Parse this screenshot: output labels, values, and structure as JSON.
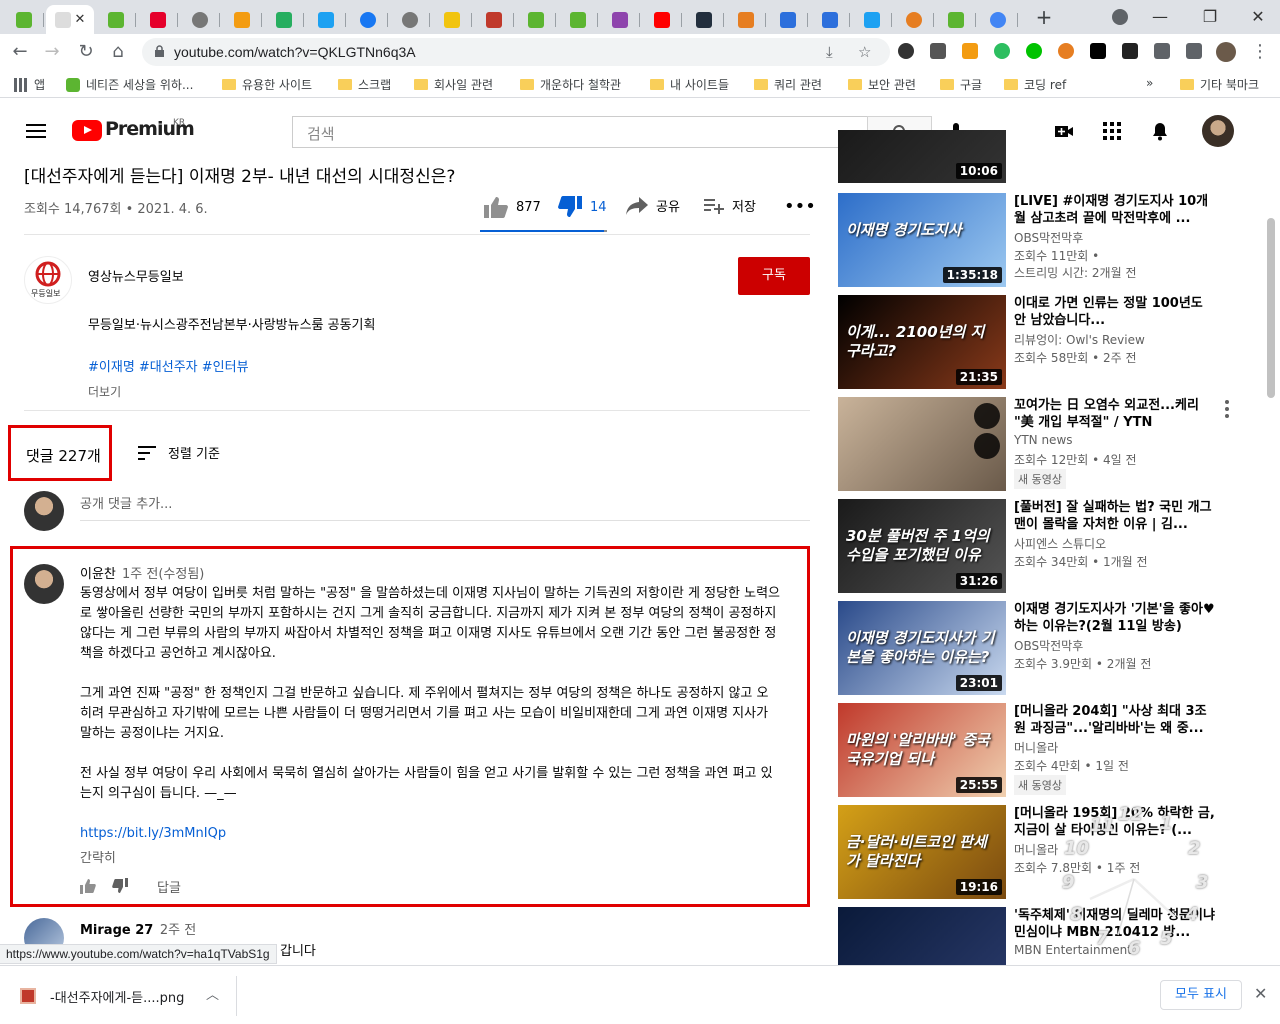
{
  "browser": {
    "url": "youtube.com/watch?v=QKLGTNn6q3A",
    "status_url": "https://www.youtube.com/watch?v=ha1qTVabS1g",
    "bookmarks": [
      "앱",
      "네티즌 세상을 위하...",
      "유용한 사이트",
      "스크랩",
      "회사일 관련",
      "개운하다 철학관",
      "내 사이트들",
      "쿼리 관련",
      "보안 관련",
      "구글",
      "코딩 ref",
      "»",
      "기타 북마크"
    ]
  },
  "header": {
    "brand": "Premium",
    "brand_region": "KR",
    "search_placeholder": "검색"
  },
  "video": {
    "title": "[대선주자에게 듣는다] 이재명 2부- 내년 대선의 시대정신은?",
    "views_date": "조회수 14,767회 • 2021. 4. 6.",
    "likes": "877",
    "dislikes": "14",
    "like_ratio": 0.98,
    "share": "공유",
    "save": "저장"
  },
  "channel": {
    "name": "영상뉴스무등일보",
    "logo_text": "무등일보",
    "subscribe": "구독",
    "description": "무등일보·뉴시스광주전남본부·사랑방뉴스룸 공동기획",
    "tags": "#이재명 #대선주자 #인터뷰",
    "more": "더보기"
  },
  "comments": {
    "count": "댓글 227개",
    "sort": "정렬 기준",
    "add_placeholder": "공개 댓글 추가...",
    "first": {
      "author": "이윤찬",
      "time": "1주 전(수정됨)",
      "paragraphs": [
        "동영상에서 정부 여당이 입버릇 처럼 말하는 \"공정\" 을 말씀하셨는데 이재명 지사님이 말하는 기득권의 저항이란 게 정당한 노력으로 쌓아올린 선량한 국민의 부까지 포함하시는 건지 그게 솔직히 궁금합니다. 지금까지 제가 지켜 본 정부 여당의 정책이 공정하지 않다는 게 그런 부류의 사람의 부까지 싸잡아서 차별적인 정책을 펴고 이재명 지사도 유튜브에서 오랜 기간 동안 그런 불공정한 정책을 하겠다고 공언하고 계시잖아요.",
        "그게 과연 진짜 \"공정\" 한 정책인지 그걸 반문하고 싶습니다. 제 주위에서 펼쳐지는 정부 여당의 정책은 하나도 공정하지 않고 오히려 무관심하고 자기밖에 모르는 나쁜 사람들이 더 떵떵거리면서 기를 펴고 사는 모습이 비일비재한데 그게 과연 이재명 지사가 말하는 공정이냐는 거지요.",
        "전 사실 정부 여당이 우리 사회에서 묵묵히 열심히 살아가는 사람들이 힘을 얻고 사기를 발휘할 수 있는 그런 정책을 과연 펴고 있는지 의구심이 듭니다. —_—"
      ],
      "link": "https://bit.ly/3mMnIQp",
      "summary": "간략히",
      "reply": "답글"
    },
    "second": {
      "author": "Mirage 27",
      "time": "2주 전",
      "text": "갑니다"
    }
  },
  "sidebar": {
    "videos": [
      {
        "title": "",
        "channel": "",
        "meta": "",
        "duration": "10:06",
        "thumb_text": "",
        "thumb_colors": [
          "#1a1a1a",
          "#333"
        ]
      },
      {
        "title": "[LIVE] #이재명 경기도지사 10개월 삼고초려 끝에 막전막후에 ...",
        "channel": "OBS막전막후",
        "meta": "조회수 11만회 •",
        "meta2": "스트리밍 시간: 2개월 전",
        "duration": "1:35:18",
        "thumb_text": "이재명 경기도지사",
        "thumb_colors": [
          "#2d6ec9",
          "#9cc8f0"
        ]
      },
      {
        "title": "이대로 가면 인류는 정말 100년도 안 남았습니다...",
        "channel": "리뷰엉이: Owl's Review",
        "meta": "조회수 58만회 • 2주 전",
        "duration": "21:35",
        "thumb_text": "이게... 2100년의 지구라고?",
        "thumb_colors": [
          "#000",
          "#8a3a1a"
        ]
      },
      {
        "title": "꼬여가는 日 오염수 외교전...케리 \"美 개입 부적절\" / YTN",
        "channel": "YTN news",
        "meta": "조회수 12만회 • 4일 전",
        "badge": "새 동영상",
        "duration": "",
        "thumb_text": "",
        "thumb_colors": [
          "#c9b39a",
          "#6a5a4a"
        ]
      },
      {
        "title": "[풀버전] 잘 실패하는 법? 국민 개그맨이 몰락을 자처한 이유 | 김...",
        "channel": "사피엔스 스튜디오",
        "meta": "조회수 34만회 • 1개월 전",
        "duration": "31:26",
        "thumb_text": "30분 풀버전 주 1억의 수입을 포기했던 이유",
        "thumb_colors": [
          "#1a1a1a",
          "#555"
        ]
      },
      {
        "title": "이재명 경기도지사가 '기본'을 좋아♥하는 이유는?(2월 11일 방송)",
        "channel": "OBS막전막후",
        "meta": "조회수 3.9만회 • 2개월 전",
        "duration": "23:01",
        "thumb_text": "이재명 경기도지사가 기본을 좋아하는 이유는?",
        "thumb_colors": [
          "#2a4a8a",
          "#c9d9ef"
        ]
      },
      {
        "title": "[머니올라 204회] \"사상 최대 3조 원 과징금\"...'알리바바'는 왜 중...",
        "channel": "머니올라",
        "meta": "조회수 4만회 • 1일 전",
        "badge": "새 동영상",
        "duration": "25:55",
        "thumb_text": "마윈의 '알리바바' 중국 국유기업 되나",
        "thumb_colors": [
          "#c0392b",
          "#f0d0b0"
        ]
      },
      {
        "title": "[머니올라 195회] 20% 하락한 금, 지금이 살 타이밍인 이유는? (...",
        "channel": "머니올라",
        "meta": "조회수 7.8만회 • 1주 전",
        "duration": "19:16",
        "thumb_text": "금·달러·비트코인 판세가 달라진다",
        "thumb_colors": [
          "#d4a017",
          "#7a4a10"
        ]
      },
      {
        "title": "'독주체제' 이재명의 딜레마 청문이냐 민심이냐 MBN 210412 방...",
        "channel": "MBN Entertainment",
        "meta": "",
        "duration": "",
        "thumb_text": "",
        "thumb_colors": [
          "#0a1a3a",
          "#2a3a6a"
        ]
      }
    ]
  },
  "clock_numerals": [
    "11",
    "12",
    "1",
    "2",
    "3",
    "4",
    "5",
    "6",
    "7",
    "8",
    "9",
    "10"
  ],
  "download": {
    "filename": "-대선주자에게-듣....png",
    "show_all": "모두 표시"
  }
}
